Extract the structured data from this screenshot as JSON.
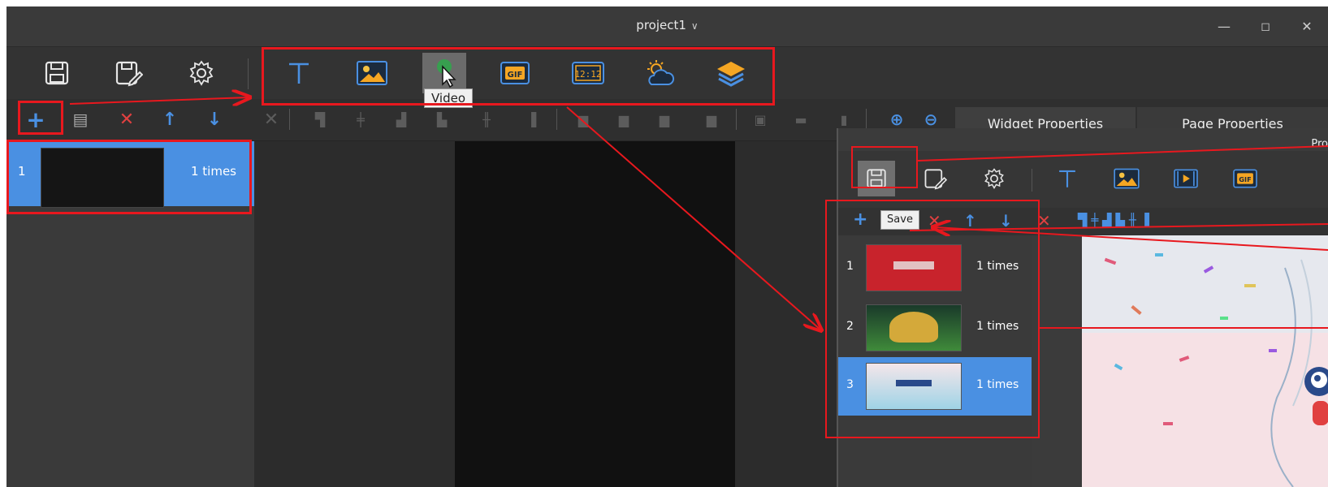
{
  "window": {
    "title": "project1",
    "minimize": "—",
    "maximize": "◻",
    "close": "✕"
  },
  "toolbar": {
    "left_icons": [
      "save-icon",
      "save-as-icon",
      "settings-icon"
    ],
    "widget_icons": [
      "text-icon",
      "image-icon",
      "video-icon",
      "gif-icon",
      "clock-icon",
      "weather-icon",
      "layers-icon"
    ],
    "clock_label": "12:12",
    "gif_label": "GIF",
    "text_label": "T",
    "tooltip": "Video"
  },
  "toolbar2": {
    "add": "+",
    "copy": "▤",
    "delete": "✕",
    "up": "↑",
    "down": "↓",
    "tabs": [
      "Widget Properties",
      "Page Properties"
    ]
  },
  "program_list": [
    {
      "index": "1",
      "times": "1  times"
    }
  ],
  "inset": {
    "title_fragment": "Pro",
    "save_tooltip": "Save",
    "rows": [
      {
        "index": "1",
        "times": "1  times",
        "thumb_color": "#c8232c"
      },
      {
        "index": "2",
        "times": "1  times",
        "thumb_color": "#2f6b3a"
      },
      {
        "index": "3",
        "times": "1  times",
        "thumb_color": "#9fd3e6"
      }
    ],
    "selected_row": 3
  },
  "colors": {
    "accent": "#4a90e2",
    "annotation": "#e8181e",
    "delete": "#e04040"
  }
}
